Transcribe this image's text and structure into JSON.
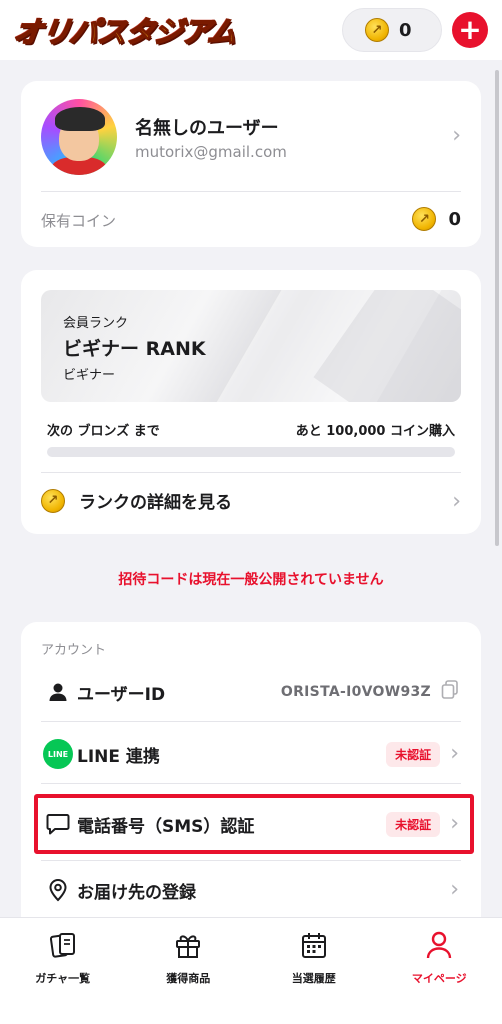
{
  "header": {
    "logo_text": "オリパスタジアム",
    "coin_balance": "0",
    "add_label": "+"
  },
  "profile": {
    "name": "名無しのユーザー",
    "email": "mutorix@gmail.com",
    "coins_label": "保有コイン",
    "coins_value": "0"
  },
  "rank": {
    "label": "会員ランク",
    "name": "ビギナー RANK",
    "sub": "ビギナー",
    "next_left": "次の ブロンズ まで",
    "next_right": "あと 100,000 コイン購入",
    "progress": 0,
    "detail_link": "ランクの詳細を見る"
  },
  "notice": "招待コードは現在一般公開されていません",
  "account": {
    "section_title": "アカウント",
    "rows": [
      {
        "label": "ユーザーID",
        "value": "ORISTA-I0VOW93Z"
      },
      {
        "label": "LINE 連携",
        "badge": "未認証",
        "icon_text": "LINE"
      },
      {
        "label": "電話番号（SMS）認証",
        "badge": "未認証"
      },
      {
        "label": "お届け先の登録"
      }
    ]
  },
  "nav": [
    {
      "label": "ガチャ一覧",
      "icon": "cards-icon"
    },
    {
      "label": "獲得商品",
      "icon": "gift-icon"
    },
    {
      "label": "当選履歴",
      "icon": "calendar-icon"
    },
    {
      "label": "マイページ",
      "icon": "person-icon",
      "active": true
    }
  ],
  "colors": {
    "accent": "#e8112d",
    "coin": "#f0b400",
    "line": "#06c755"
  }
}
